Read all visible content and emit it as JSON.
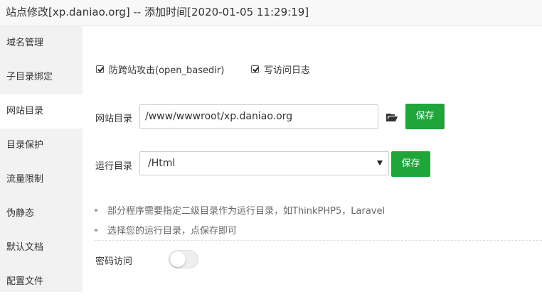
{
  "window": {
    "title": "站点修改[xp.daniao.org] -- 添加时间[2020-01-05 11:29:19]"
  },
  "sidebar": {
    "items": [
      {
        "label": "域名管理"
      },
      {
        "label": "子目录绑定"
      },
      {
        "label": "网站目录",
        "active": true
      },
      {
        "label": "目录保护"
      },
      {
        "label": "流量限制"
      },
      {
        "label": "伪静态"
      },
      {
        "label": "默认文档"
      },
      {
        "label": "配置文件"
      }
    ]
  },
  "main": {
    "checkboxes": [
      {
        "label": "防跨站攻击(open_basedir)",
        "checked": true
      },
      {
        "label": "写访问日志",
        "checked": true
      }
    ],
    "site_dir": {
      "label": "网站目录",
      "value": "/www/wwwroot/xp.daniao.org",
      "save_label": "保存"
    },
    "run_dir": {
      "label": "运行目录",
      "value": "/Html",
      "save_label": "保存"
    },
    "tips": [
      "部分程序需要指定二级目录作为运行目录，如ThinkPHP5，Laravel",
      "选择您的运行目录，点保存即可"
    ],
    "password_access": {
      "label": "密码访问",
      "enabled": false
    }
  },
  "colors": {
    "accent": "#20a53a",
    "sidebar_bg": "#f2f2f2"
  },
  "icons": {
    "folder": "folder-open-icon",
    "dropdown": "caret-down-icon"
  }
}
